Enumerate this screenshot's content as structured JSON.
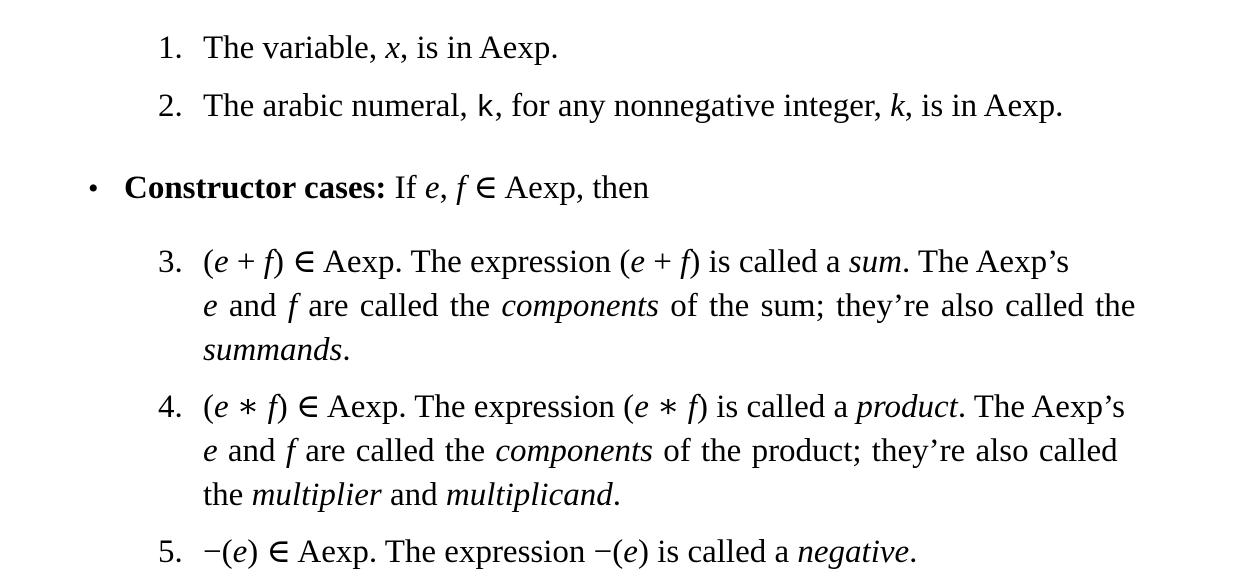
{
  "items": {
    "item1": {
      "number": "1.",
      "text_a": "The variable, ",
      "var_x": "x",
      "text_b": ", is in Aexp."
    },
    "item2": {
      "number": "2.",
      "text_a": "The arabic numeral, ",
      "mono_k": "k",
      "text_b": ", for any nonnegative integer, ",
      "var_k": "k",
      "text_c": ", is in Aexp."
    }
  },
  "constructor": {
    "bullet": "•",
    "heading": "Constructor cases:",
    "text_a": " If ",
    "var_e": "e",
    "comma": ", ",
    "var_f": "f",
    "text_b": " ∈ Aexp, then"
  },
  "case3": {
    "number": "3.",
    "line1": {
      "paren_open": "(",
      "e": "e",
      "plus": " + ",
      "f": "f",
      "paren_close": ")",
      "t1": " ∈ Aexp. The expression (",
      "e2": "e",
      "plus2": " + ",
      "f2": "f",
      "t2": ") is called a ",
      "sum": "sum",
      "t3": ". The Aexp’s"
    },
    "line2": {
      "e": "e",
      "t1": " and ",
      "f": "f",
      "t2": " are called the ",
      "components": "components",
      "t3": " of the sum; they’re also called the"
    },
    "line3": {
      "summands": "summands",
      "t1": "."
    }
  },
  "case4": {
    "number": "4.",
    "line1": {
      "paren_open": "(",
      "e": "e",
      "star": " ∗ ",
      "f": "f",
      "t1": ") ∈ Aexp. The expression (",
      "e2": "e",
      "star2": " ∗ ",
      "f2": "f",
      "t2": ") is called a ",
      "product": "product",
      "t3": ". The Aexp’s"
    },
    "line2": {
      "e": "e",
      "t1": " and ",
      "f": "f",
      "t2": " are called the ",
      "components": "components",
      "t3": " of the product; they’re also called"
    },
    "line3": {
      "t1": "the ",
      "multiplier": "multiplier",
      "t2": " and ",
      "multiplicand": "multiplicand",
      "t3": "."
    }
  },
  "case5": {
    "number": "5.",
    "t1": "−(",
    "e": "e",
    "t2": ") ∈ Aexp. The expression −(",
    "e2": "e",
    "t3": ") is called a ",
    "negative": "negative",
    "t4": "."
  }
}
